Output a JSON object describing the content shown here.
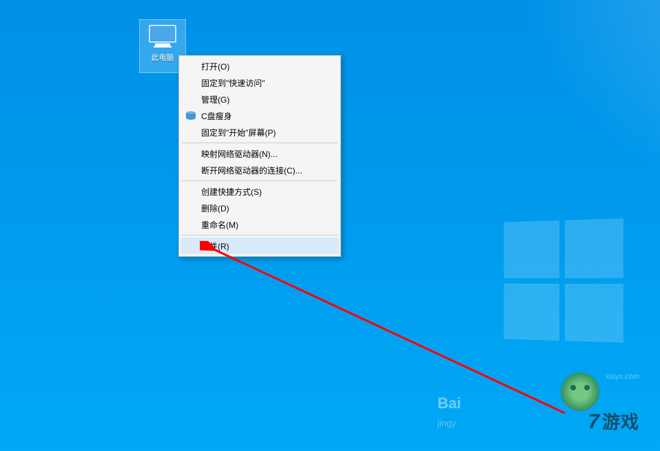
{
  "desktop": {
    "icon_label": "此电脑"
  },
  "context_menu": {
    "items": [
      {
        "label": "打开(O)",
        "icon": null
      },
      {
        "label": "固定到\"快速访问\"",
        "icon": null
      },
      {
        "label": "管理(G)",
        "icon": null
      },
      {
        "label": "C盘瘦身",
        "icon": "disk-icon"
      },
      {
        "label": "固定到\"开始\"屏幕(P)",
        "icon": null
      }
    ],
    "items2": [
      {
        "label": "映射网络驱动器(N)...",
        "icon": null
      },
      {
        "label": "断开网络驱动器的连接(C)...",
        "icon": null
      }
    ],
    "items3": [
      {
        "label": "创建快捷方式(S)",
        "icon": null
      },
      {
        "label": "删除(D)",
        "icon": null
      },
      {
        "label": "重命名(M)",
        "icon": null
      }
    ],
    "items4": [
      {
        "label": "属性(R)",
        "icon": null,
        "highlighted": true
      }
    ]
  },
  "watermarks": {
    "url": "xiayx.com",
    "logo_text": "游戏",
    "baidu_text": "Bai",
    "baidu_sub": "jingy",
    "seven": "7"
  }
}
